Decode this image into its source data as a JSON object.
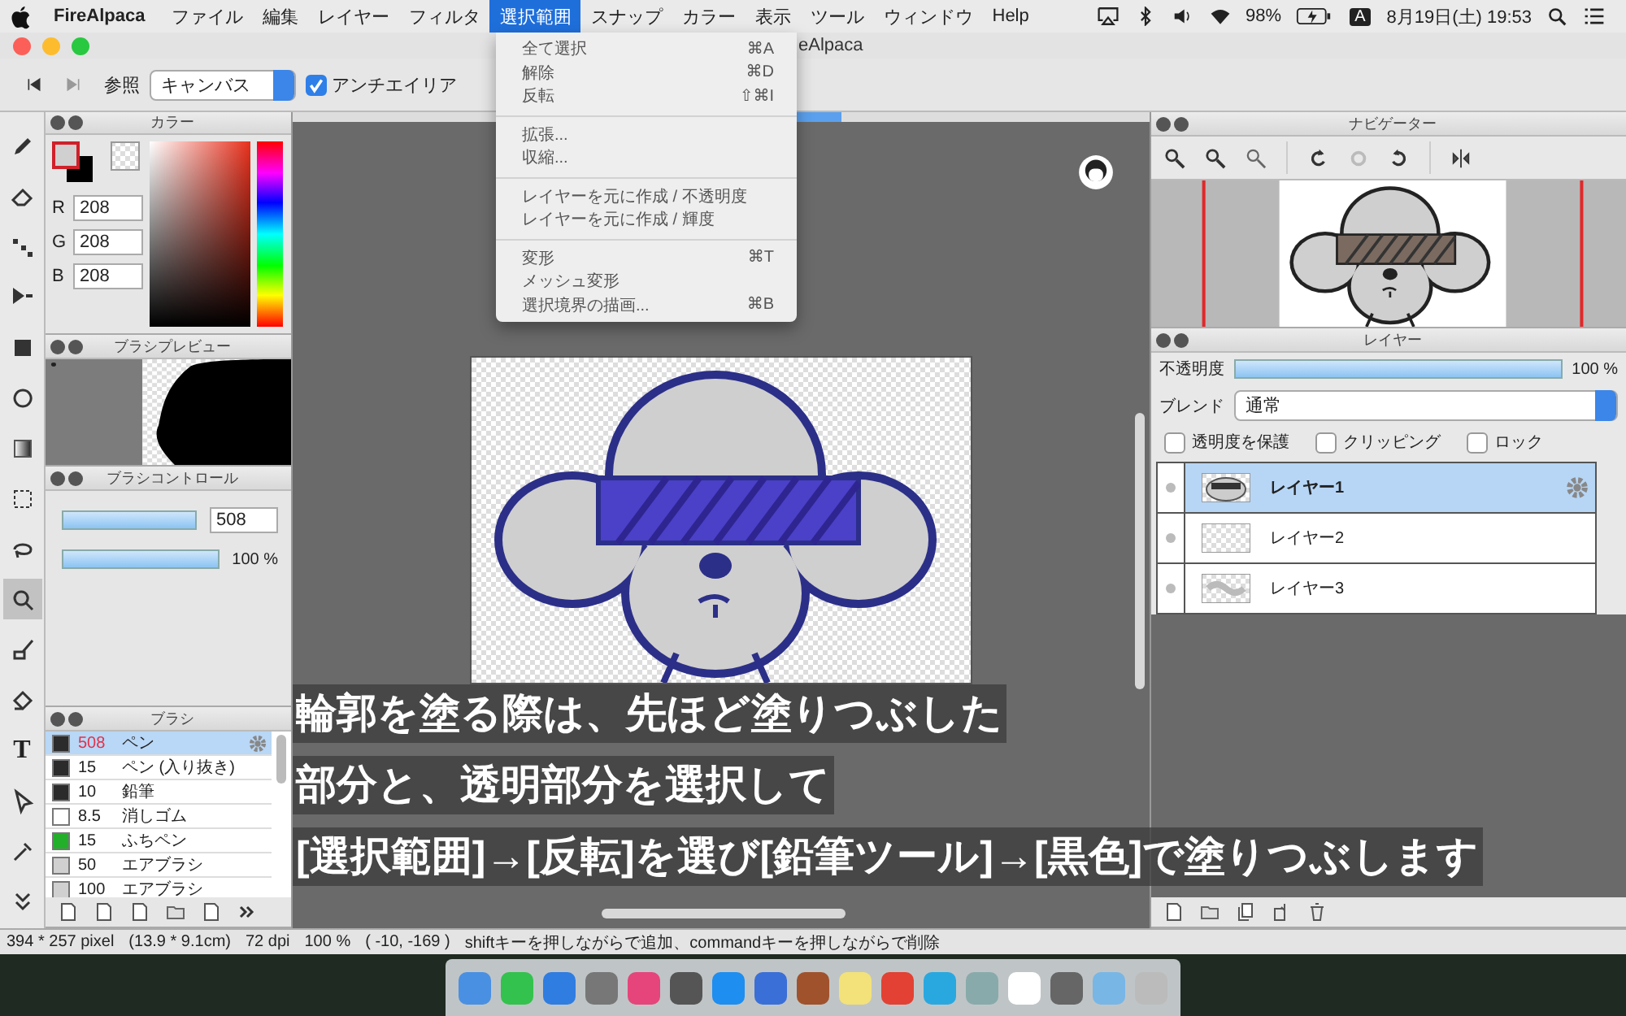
{
  "menubar": {
    "app": "FireAlpaca",
    "menus": [
      {
        "label": "ファイル",
        "selected": false
      },
      {
        "label": "編集",
        "selected": false
      },
      {
        "label": "レイヤー",
        "selected": false
      },
      {
        "label": "フィルタ",
        "selected": false
      },
      {
        "label": "選択範囲",
        "selected": true
      },
      {
        "label": "スナップ",
        "selected": false
      },
      {
        "label": "カラー",
        "selected": false
      },
      {
        "label": "表示",
        "selected": false
      },
      {
        "label": "ツール",
        "selected": false
      },
      {
        "label": "ウィンドウ",
        "selected": false
      },
      {
        "label": "Help",
        "selected": false
      }
    ],
    "battery": "98%",
    "input_source": "A",
    "clock": "8月19日(土)  19:53"
  },
  "menu_dropdown": {
    "groups": [
      [
        {
          "label": "全て選択",
          "shortcut": "⌘A"
        },
        {
          "label": "解除",
          "shortcut": "⌘D"
        },
        {
          "label": "反転",
          "shortcut": "⇧⌘I"
        }
      ],
      [
        {
          "label": "拡張..."
        },
        {
          "label": "収縮..."
        }
      ],
      [
        {
          "label": "レイヤーを元に作成 / 不透明度"
        },
        {
          "label": "レイヤーを元に作成 / 輝度"
        }
      ],
      [
        {
          "label": "変形",
          "shortcut": "⌘T"
        },
        {
          "label": "メッシュ変形"
        },
        {
          "label": "選択境界の描画...",
          "shortcut": "⌘B"
        }
      ]
    ]
  },
  "window": {
    "title": "eAlpaca"
  },
  "toolbar": {
    "reference_label": "参照",
    "reference_value": "キャンバス",
    "antialias": {
      "label": "アンチエイリア",
      "checked": true
    }
  },
  "tools": [
    {
      "kind": "pencil",
      "selected": false
    },
    {
      "kind": "eraser",
      "selected": false
    },
    {
      "kind": "dots",
      "selected": false
    },
    {
      "kind": "move",
      "selected": false
    },
    {
      "kind": "square",
      "selected": false
    },
    {
      "kind": "ring",
      "selected": false
    },
    {
      "kind": "gradient",
      "selected": false
    },
    {
      "kind": "selection",
      "selected": false
    },
    {
      "kind": "lasso",
      "selected": false
    },
    {
      "kind": "magnifier",
      "selected": true
    },
    {
      "kind": "brush",
      "selected": false
    },
    {
      "kind": "bucket",
      "selected": false
    },
    {
      "kind": "text",
      "label": "T",
      "selected": false
    },
    {
      "kind": "pointer",
      "selected": false
    },
    {
      "kind": "dropper",
      "selected": false
    },
    {
      "kind": "chevron",
      "selected": false
    }
  ],
  "color_panel": {
    "title": "カラー",
    "fields": [
      {
        "label": "R",
        "value": "208"
      },
      {
        "label": "G",
        "value": "208"
      },
      {
        "label": "B",
        "value": "208"
      }
    ]
  },
  "brush_preview": {
    "title": "ブラシプレビュー"
  },
  "brush_control": {
    "title": "ブラシコントロール",
    "sliders": [
      {
        "kind": "field",
        "level": 1,
        "reading": "508"
      },
      {
        "kind": "text",
        "level": 1,
        "reading": "100 %"
      }
    ]
  },
  "brushes": {
    "title": "ブラシ",
    "items": [
      {
        "size": "508",
        "name": "ペン",
        "color": "#2b2b2b",
        "selected": true
      },
      {
        "size": "15",
        "name": "ペン (入り抜き)",
        "color": "#2b2b2b",
        "selected": false
      },
      {
        "size": "10",
        "name": "鉛筆",
        "color": "#2b2b2b",
        "selected": false
      },
      {
        "size": "8.5",
        "name": "消しゴム",
        "color": "#ffffff",
        "selected": false
      },
      {
        "size": "15",
        "name": "ふちペン",
        "color": "#22b02a",
        "selected": false
      },
      {
        "size": "50",
        "name": "エアブラシ",
        "color": "#d0d0d0",
        "selected": false
      },
      {
        "size": "100",
        "name": "エアブラシ",
        "color": "#d0d0d0",
        "selected": false
      }
    ]
  },
  "caption": [
    "輪郭を塗る際は、先ほど塗りつぶした",
    "部分と、透明部分を選択して",
    "[選択範囲]→[反転]を選び[鉛筆ツール]→[黒色]で塗りつぶします"
  ],
  "navigator": {
    "title": "ナビゲーター"
  },
  "layers": {
    "title": "レイヤー",
    "opacity": {
      "label": "不透明度",
      "level": 1,
      "reading": "100 %"
    },
    "blend": {
      "label": "ブレンド",
      "value": "通常"
    },
    "options": [
      {
        "label": "透明度を保護",
        "checked": false
      },
      {
        "label": "クリッピング",
        "checked": false
      },
      {
        "label": "ロック",
        "checked": false
      }
    ],
    "items": [
      {
        "name": "レイヤー1",
        "kind": "drawing",
        "selected": true
      },
      {
        "name": "レイヤー2",
        "kind": "empty",
        "selected": false
      },
      {
        "name": "レイヤー3",
        "kind": "sketch",
        "selected": false
      }
    ]
  },
  "status_bar": {
    "items": [
      "394 * 257 pixel",
      "(13.9 * 9.1cm)",
      "72 dpi",
      "100 %",
      "( -10, -169 )",
      "shiftキーを押しながらで追加、commandキーを押しながらで削除"
    ]
  }
}
